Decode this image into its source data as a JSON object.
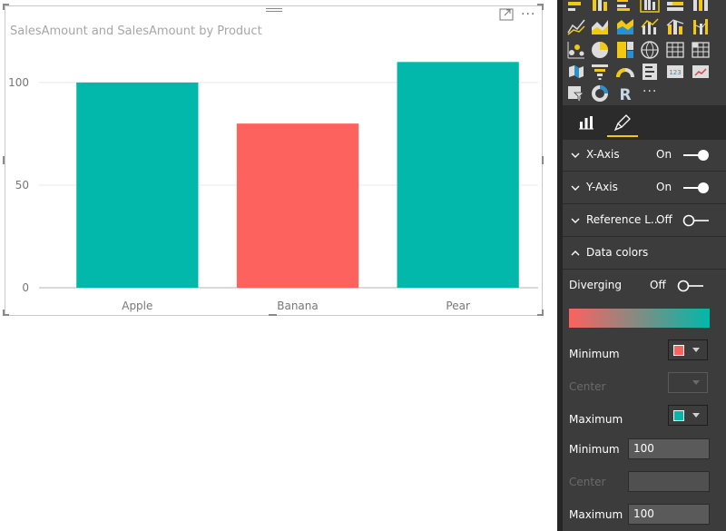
{
  "visual": {
    "title": "SalesAmount and SalesAmount by Product",
    "more_label": "···"
  },
  "chart_data": {
    "type": "bar",
    "categories": [
      "Apple",
      "Banana",
      "Pear"
    ],
    "values": [
      100,
      80,
      110
    ],
    "colors": [
      "#01b8aa",
      "#fd625e",
      "#01b8aa"
    ],
    "title": "SalesAmount and SalesAmount by Product",
    "ylim": [
      0,
      115
    ],
    "yticks": [
      0,
      50,
      100
    ],
    "grid": true,
    "legend": "none"
  },
  "pane": {
    "gallery_more": "···",
    "sections": [
      {
        "label": "X-Axis",
        "state": "On",
        "expanded": false
      },
      {
        "label": "Y-Axis",
        "state": "On",
        "expanded": false
      },
      {
        "label": "Reference L...",
        "state": "Off",
        "expanded": false
      },
      {
        "label": "Data colors",
        "state": "",
        "expanded": true
      }
    ],
    "data_colors": {
      "diverging_label": "Diverging",
      "diverging_state": "Off",
      "minimum_label": "Minimum",
      "center_label": "Center",
      "maximum_label": "Maximum",
      "min_color": "#fd625e",
      "max_color": "#01b8aa",
      "min_value_label": "Minimum",
      "min_value": "100",
      "center_value_label": "Center",
      "center_value": "",
      "max_value_label": "Maximum",
      "max_value": "100"
    }
  },
  "colors": {
    "accent": "#f2c811",
    "teal": "#01b8aa",
    "salmon": "#fd625e"
  }
}
